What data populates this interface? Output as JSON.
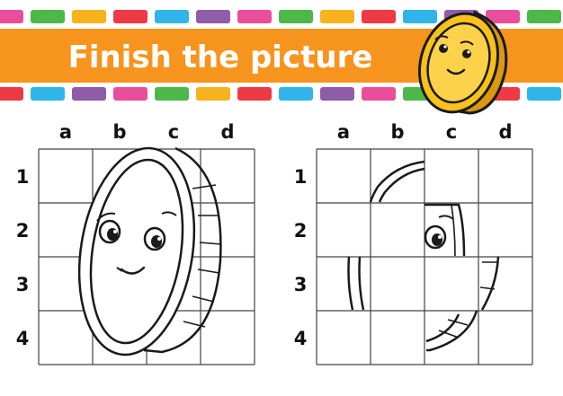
{
  "header": {
    "title": "Finish the picture",
    "banner_color": "#f7941d",
    "swatch_colors": [
      "#e94e9a",
      "#4db848",
      "#f7b21e",
      "#ee3a43",
      "#2fb5e9",
      "#8e5ca8"
    ]
  },
  "grids": {
    "column_labels": [
      "a",
      "b",
      "c",
      "d"
    ],
    "row_labels": [
      "1",
      "2",
      "3",
      "4"
    ]
  },
  "mascot": {
    "icon": "gold-coin-icon",
    "fill_color": "#f9c21b",
    "outline_color": "#1a1a1a"
  }
}
